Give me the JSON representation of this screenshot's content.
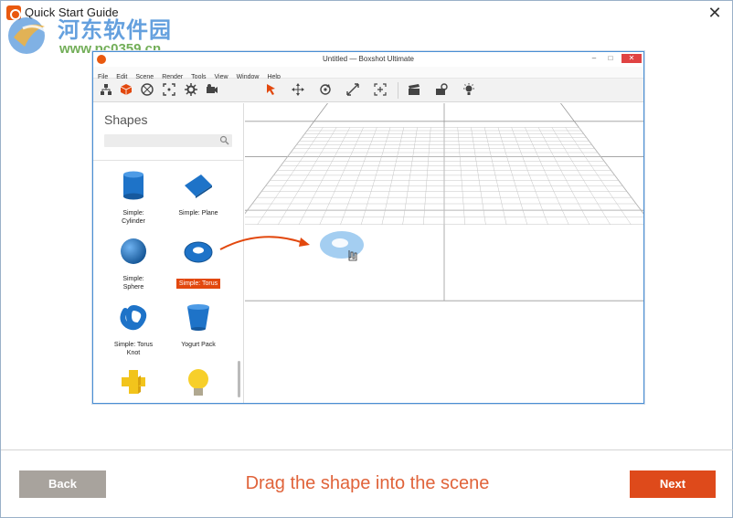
{
  "window": {
    "title": "Quick Start Guide",
    "close_glyph": "✕"
  },
  "watermark": {
    "site_name": "河东软件园",
    "url": "www.pc0359.cn"
  },
  "app": {
    "title": "Untitled — Boxshot Ultimate",
    "menu": [
      "File",
      "Edit",
      "Scene",
      "Render",
      "Tools",
      "View",
      "Window",
      "Help"
    ],
    "toolbar_icons": [
      "scene-tree-icon",
      "shapes-icon",
      "materials-icon",
      "frame-icon",
      "settings-icon",
      "camera-icon",
      "select-arrow-icon",
      "move-icon",
      "rotate-icon",
      "scale-icon",
      "fit-icon",
      "render-clap-icon",
      "render-settings-icon",
      "light-icon"
    ],
    "sidebar": {
      "title": "Shapes",
      "shapes": [
        {
          "label_line1": "Simple:",
          "label_line2": "Cylinder",
          "icon": "cylinder-icon",
          "selected": false
        },
        {
          "label_line1": "Simple: Plane",
          "label_line2": "",
          "icon": "plane-icon",
          "selected": false
        },
        {
          "label_line1": "Simple:",
          "label_line2": "Sphere",
          "icon": "sphere-icon",
          "selected": false
        },
        {
          "label_line1": "Simple: Torus",
          "label_line2": "",
          "icon": "torus-icon",
          "selected": true
        },
        {
          "label_line1": "Simple: Torus",
          "label_line2": "Knot",
          "icon": "torus-knot-icon",
          "selected": false
        },
        {
          "label_line1": "Yogurt Pack",
          "label_line2": "",
          "icon": "yogurt-pack-icon",
          "selected": false
        },
        {
          "label_line1": "",
          "label_line2": "",
          "icon": "cross-shape-icon",
          "selected": false
        },
        {
          "label_line1": "",
          "label_line2": "",
          "icon": "bulb-icon",
          "selected": false
        }
      ]
    },
    "accent_color": "#e2480e",
    "shape_color": "#1e73c8"
  },
  "footer": {
    "back_label": "Back",
    "next_label": "Next",
    "instruction": "Drag the shape into the scene",
    "back_color": "#a8a39d",
    "next_color": "#de4a1b"
  }
}
